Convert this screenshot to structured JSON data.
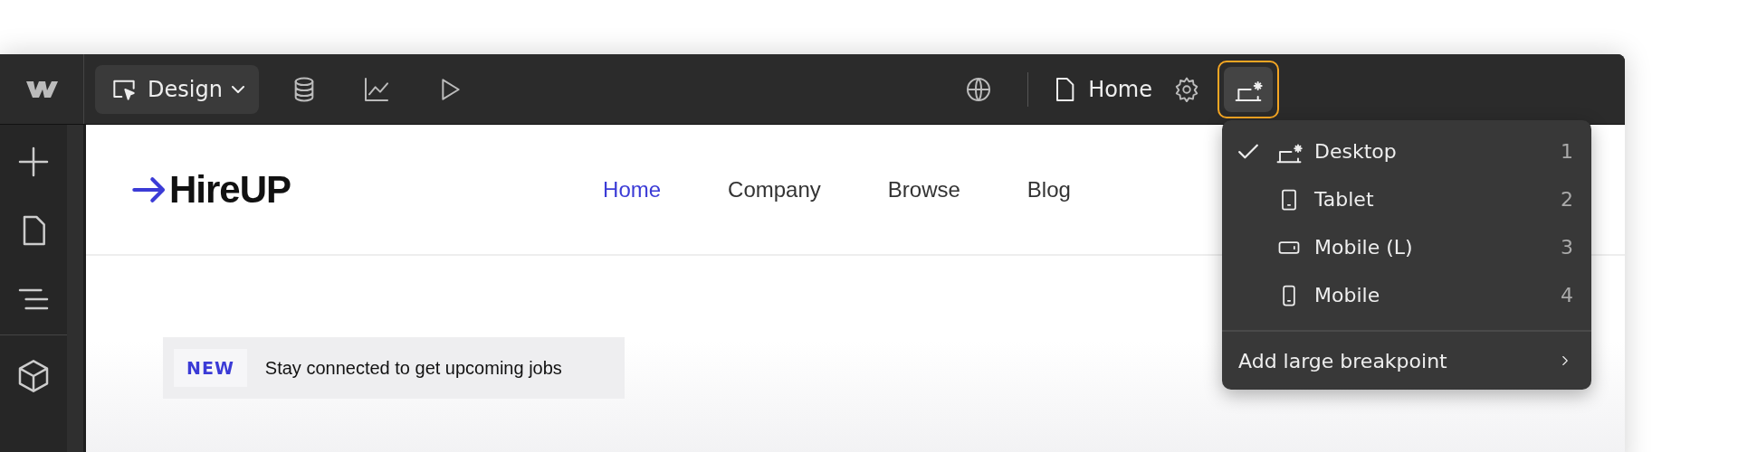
{
  "toolbar": {
    "mode_button": {
      "label": "Design"
    },
    "page": {
      "label": "Home"
    }
  },
  "breakpoint_menu": {
    "items": [
      {
        "label": "Desktop",
        "shortcut": "1",
        "kind": "desktop",
        "selected": true
      },
      {
        "label": "Tablet",
        "shortcut": "2",
        "kind": "tablet",
        "selected": false
      },
      {
        "label": "Mobile (L)",
        "shortcut": "3",
        "kind": "landscape",
        "selected": false
      },
      {
        "label": "Mobile",
        "shortcut": "4",
        "kind": "portrait",
        "selected": false
      }
    ],
    "add_item": {
      "label": "Add large breakpoint"
    }
  },
  "site": {
    "brand": "HireUP",
    "nav": [
      {
        "label": "Home",
        "selected": true
      },
      {
        "label": "Company",
        "selected": false
      },
      {
        "label": "Browse",
        "selected": false
      },
      {
        "label": "Blog",
        "selected": false
      }
    ],
    "banner": {
      "badge": "NEW",
      "text": "Stay connected to get upcoming jobs"
    }
  }
}
